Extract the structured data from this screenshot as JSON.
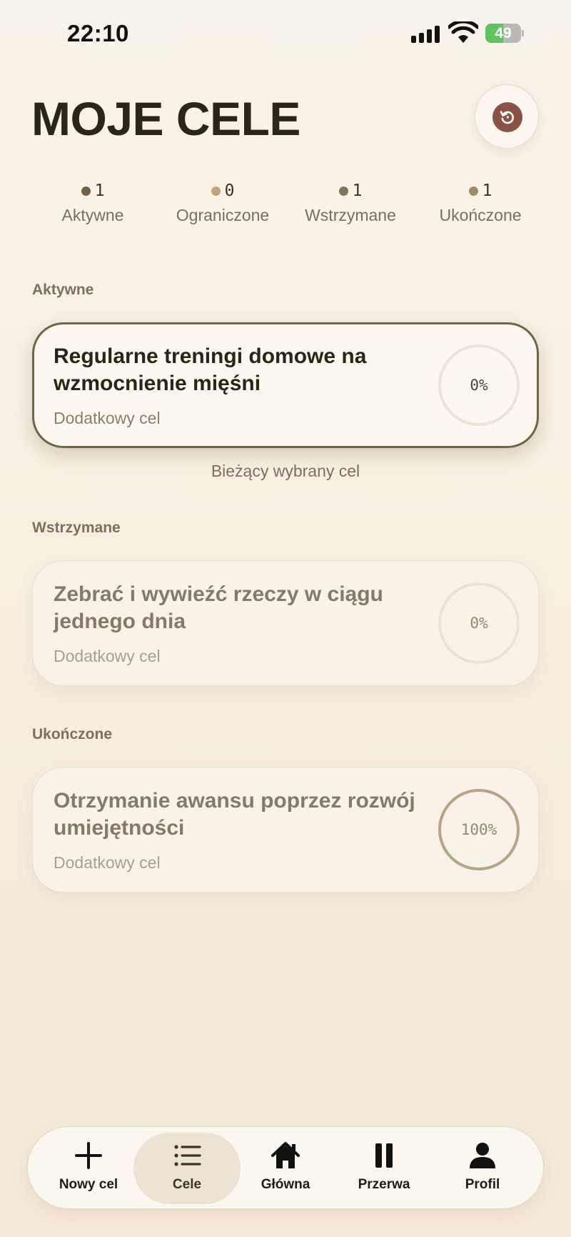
{
  "status_bar": {
    "time": "22:10",
    "battery": "49",
    "battery_level": 0.49
  },
  "header": {
    "title": "MOJE CELE",
    "refresh_icon": "refresh-icon"
  },
  "stats": [
    {
      "count": "1",
      "label": "Aktywne",
      "color": "#6f6545"
    },
    {
      "count": "0",
      "label": "Ograniczone",
      "color": "#c4a474"
    },
    {
      "count": "1",
      "label": "Wstrzymane",
      "color": "#7f7559"
    },
    {
      "count": "1",
      "label": "Ukończone",
      "color": "#a08a62"
    }
  ],
  "sections": {
    "active": {
      "label": "Aktywne",
      "goal": {
        "title": "Regularne treningi domowe na wzmocnienie mięśni",
        "subtitle": "Dodatkowy cel",
        "progress": "0%"
      },
      "caption": "Bieżący wybrany cel"
    },
    "paused": {
      "label": "Wstrzymane",
      "goal": {
        "title": "Zebrać i wywieźć rzeczy w ciągu jednego dnia",
        "subtitle": "Dodatkowy cel",
        "progress": "0%"
      }
    },
    "completed": {
      "label": "Ukończone",
      "goal": {
        "title": "Otrzymanie awansu poprzez rozwój umiejętności",
        "subtitle": "Dodatkowy cel",
        "progress": "100%"
      }
    }
  },
  "nav": [
    {
      "label": "Nowy cel",
      "icon": "plus-icon"
    },
    {
      "label": "Cele",
      "icon": "list-icon",
      "active": true
    },
    {
      "label": "Główna",
      "icon": "home-icon"
    },
    {
      "label": "Przerwa",
      "icon": "pause-icon"
    },
    {
      "label": "Profil",
      "icon": "person-icon"
    }
  ]
}
